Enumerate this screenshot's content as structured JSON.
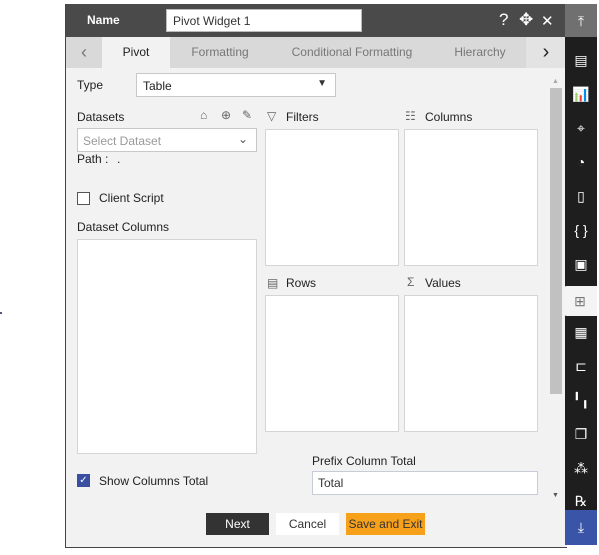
{
  "header": {
    "name_label": "Name",
    "name_value": "Pivot Widget 1",
    "help_icon": "?",
    "move_icon": "✥",
    "close_icon": "✕"
  },
  "tabs": [
    {
      "label": "Pivot",
      "active": true
    },
    {
      "label": "Formatting"
    },
    {
      "label": "Conditional Formatting"
    },
    {
      "label": "Hierarchy"
    }
  ],
  "form": {
    "type_label": "Type",
    "type_value": "Table",
    "datasets_label": "Datasets",
    "dataset_placeholder": "Select Dataset",
    "path_label": "Path :",
    "path_value": ".",
    "client_script_label": "Client Script",
    "client_script_checked": false,
    "dataset_columns_label": "Dataset Columns",
    "filters_label": "Filters",
    "columns_label": "Columns",
    "rows_label": "Rows",
    "values_label": "Values",
    "show_columns_total_label": "Show Columns Total",
    "show_columns_total_checked": true,
    "prefix_label": "Prefix Column Total",
    "prefix_value": "Total"
  },
  "footer": {
    "next": "Next",
    "cancel": "Cancel",
    "save_exit": "Save and Exit"
  },
  "colors": {
    "header": "#4a4a4a",
    "sidebar": "#1e1e1e",
    "save": "#f7a01a",
    "next": "#333333",
    "checkbox": "#3a4fa0",
    "scroll_down_button": "#3a55a8"
  },
  "sidebar": {
    "items": [
      "scroll-top",
      "table-widget",
      "chart-widget",
      "map-widget",
      "report-widget",
      "document-widget",
      "code-widget",
      "image-widget",
      "pivot-widget",
      "form-widget",
      "hierarchy-widget",
      "kpi-widget",
      "copy-widget",
      "group-widget",
      "formula-widget",
      "scroll-bottom"
    ],
    "active": "pivot-widget"
  }
}
